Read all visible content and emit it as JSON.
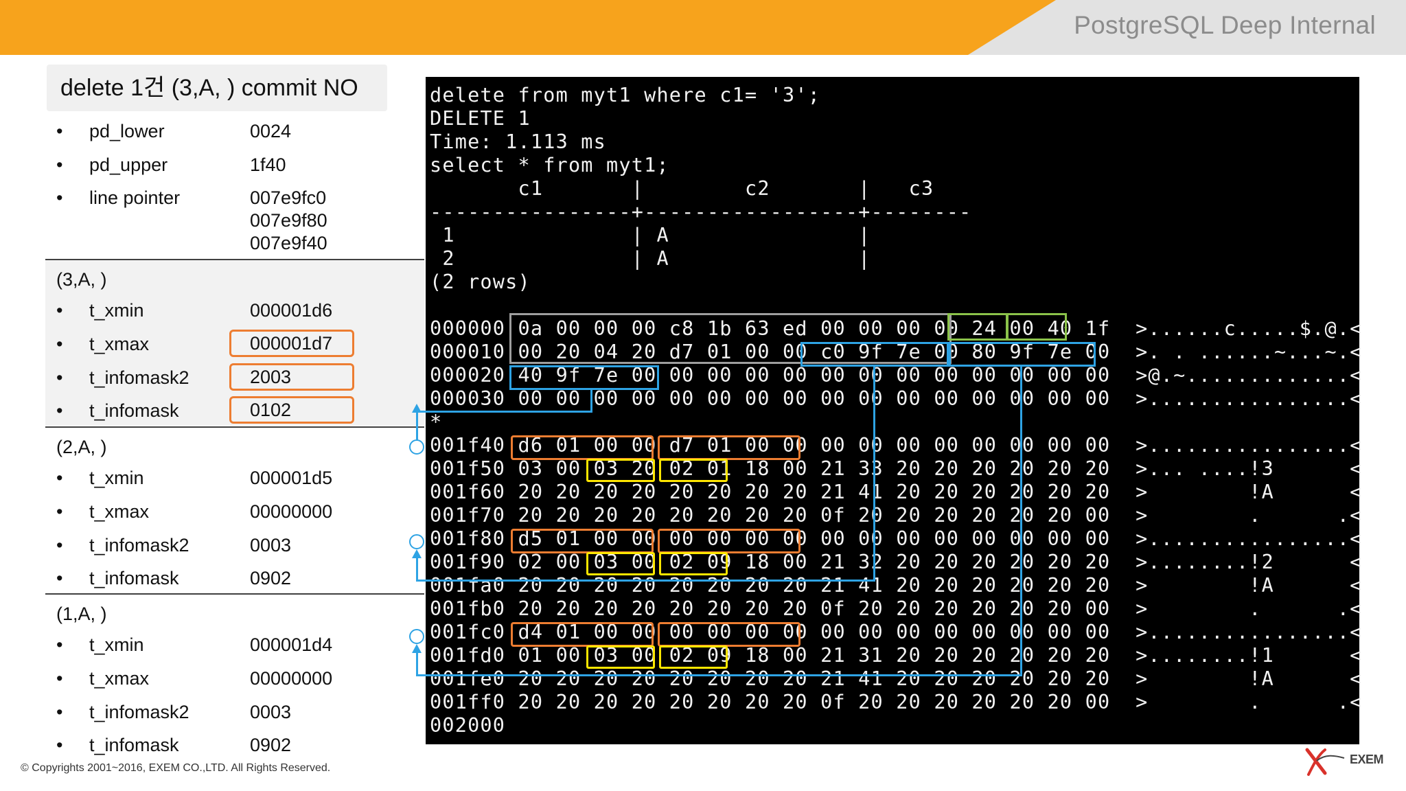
{
  "header": {
    "title": "PostgreSQL Deep Internal"
  },
  "case_title": "delete 1건 (3,A, ) commit NO",
  "page_header": {
    "rows": [
      {
        "label": "pd_lower",
        "value": "0024"
      },
      {
        "label": "pd_upper",
        "value": "1f40"
      },
      {
        "label": "line pointer",
        "values": [
          "007e9fc0",
          "007e9f80",
          "007e9f40"
        ]
      }
    ]
  },
  "tuples": [
    {
      "name": "(3,A, )",
      "t_xmin": "000001d6",
      "t_xmax": "000001d7",
      "t_infomask2": "2003",
      "t_infomask": "0102"
    },
    {
      "name": "(2,A, )",
      "t_xmin": "000001d5",
      "t_xmax": "00000000",
      "t_infomask2": "0003",
      "t_infomask": "0902"
    },
    {
      "name": "(1,A, )",
      "t_xmin": "000001d4",
      "t_xmax": "00000000",
      "t_infomask2": "0003",
      "t_infomask": "0902"
    }
  ],
  "field_labels": {
    "t_xmin": "t_xmin",
    "t_xmax": "t_xmax",
    "t_infomask2": "t_infomask2",
    "t_infomask": "t_infomask"
  },
  "bullet": "•",
  "terminal": {
    "lines": [
      "delete from myt1 where c1= '3';",
      "DELETE 1",
      "Time: 1.113 ms",
      "select * from myt1;",
      "       c1       |        c2       |   c3",
      "----------------+-----------------+--------",
      " 1              | A               |",
      " 2              | A               |",
      "(2 rows)",
      "",
      "000000 0a 00 00 00 c8 1b 63 ed 00 00 00 00 24 00 40 1f  >......c.....$.@.<",
      "000010 00 20 04 20 d7 01 00 00 c0 9f 7e 00 80 9f 7e 00  >. . ......~...~.<",
      "000020 40 9f 7e 00 00 00 00 00 00 00 00 00 00 00 00 00  >@.~.............<",
      "000030 00 00 00 00 00 00 00 00 00 00 00 00 00 00 00 00  >................<",
      "*",
      "001f40 d6 01 00 00 d7 01 00 00 00 00 00 00 00 00 00 00  >................<",
      "001f50 03 00 03 20 02 01 18 00 21 33 20 20 20 20 20 20  >... ....!3      <",
      "001f60 20 20 20 20 20 20 20 20 21 41 20 20 20 20 20 20  >        !A      <",
      "001f70 20 20 20 20 20 20 20 20 0f 20 20 20 20 20 20 00  >        .      .<",
      "001f80 d5 01 00 00 00 00 00 00 00 00 00 00 00 00 00 00  >................<",
      "001f90 02 00 03 00 02 09 18 00 21 32 20 20 20 20 20 20  >........!2      <",
      "001fa0 20 20 20 20 20 20 20 20 21 41 20 20 20 20 20 20  >        !A      <",
      "001fb0 20 20 20 20 20 20 20 20 0f 20 20 20 20 20 20 00  >        .      .<",
      "001fc0 d4 01 00 00 00 00 00 00 00 00 00 00 00 00 00 00  >................<",
      "001fd0 01 00 03 00 02 09 18 00 21 31 20 20 20 20 20 20  >........!1      <",
      "001fe0 20 20 20 20 20 20 20 20 21 41 20 20 20 20 20 20  >        !A      <",
      "001ff0 20 20 20 20 20 20 20 20 0f 20 20 20 20 20 20 00  >        .      .<",
      "002000"
    ]
  },
  "footer": {
    "copyright": "© Copyrights 2001~2016, EXEM CO.,LTD. All Rights Reserved."
  },
  "logo": {
    "text": "EXEM",
    "icon": "exem-logo-icon"
  },
  "colors": {
    "header_orange": "#f7a31c",
    "highlight_orange": "#ed7d31",
    "highlight_yellow": "#ffe600",
    "highlight_blue": "#2ea3e4",
    "highlight_green": "#8bc34a",
    "highlight_grey": "#9e9e9e"
  }
}
